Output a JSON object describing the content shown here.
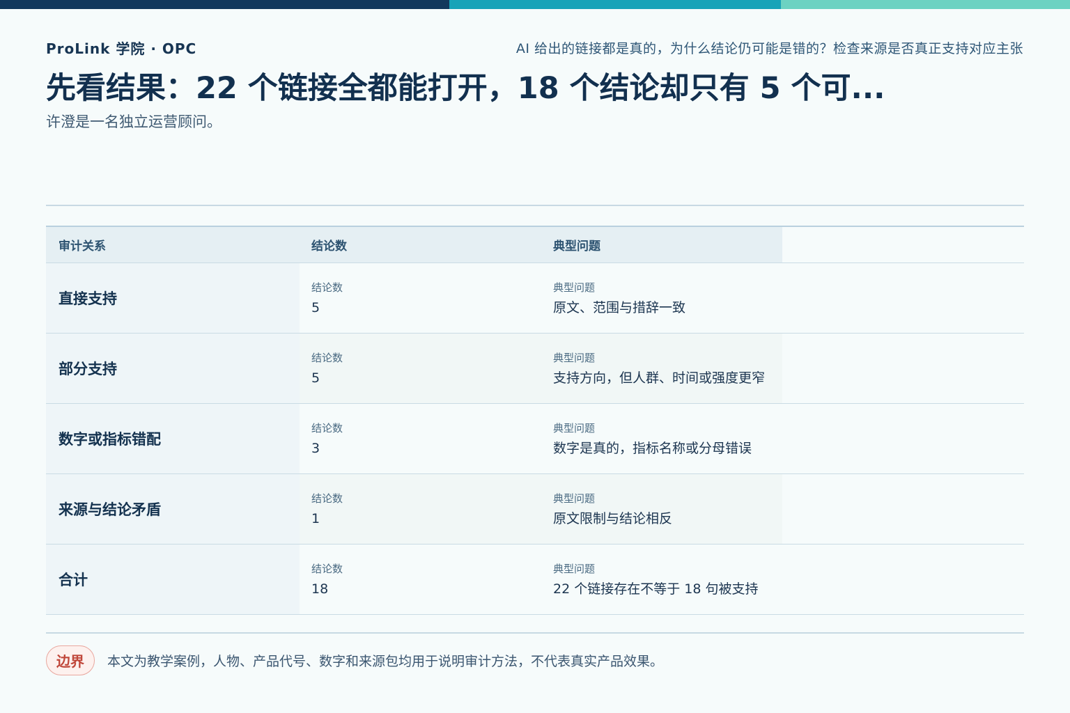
{
  "header": {
    "brand": "ProLink 学院 · OPC",
    "tagline": "AI 给出的链接都是真的，为什么结论仍可能是错的？检查来源是否真正支持对应主张",
    "title": "先看结果：22 个链接全都能打开，18 个结论却只有 5 个可...",
    "subtitle": "许澄是一名独立运营顾问。"
  },
  "table": {
    "columns": [
      "审计关系",
      "结论数",
      "典型问题"
    ],
    "cell_label_count": "结论数",
    "cell_label_issue": "典型问题",
    "rows": [
      {
        "relation": "直接支持",
        "count": "5",
        "issue": "原文、范围与措辞一致"
      },
      {
        "relation": "部分支持",
        "count": "5",
        "issue": "支持方向，但人群、时间或强度更窄"
      },
      {
        "relation": "数字或指标错配",
        "count": "3",
        "issue": "数字是真的，指标名称或分母错误"
      },
      {
        "relation": "来源与结论矛盾",
        "count": "1",
        "issue": "原文限制与结论相反"
      },
      {
        "relation": "合计",
        "count": "18",
        "issue": "22 个链接存在不等于 18 句被支持"
      }
    ]
  },
  "footer": {
    "badge": "边界",
    "note": "本文为教学案例，人物、产品代号、数字和来源包均用于说明审计方法，不代表真实产品效果。"
  },
  "colors": {
    "bar_navy": "#12385c",
    "bar_teal": "#18a3b8",
    "bar_mint": "#6cd2c2",
    "badge_red": "#c0473a"
  }
}
